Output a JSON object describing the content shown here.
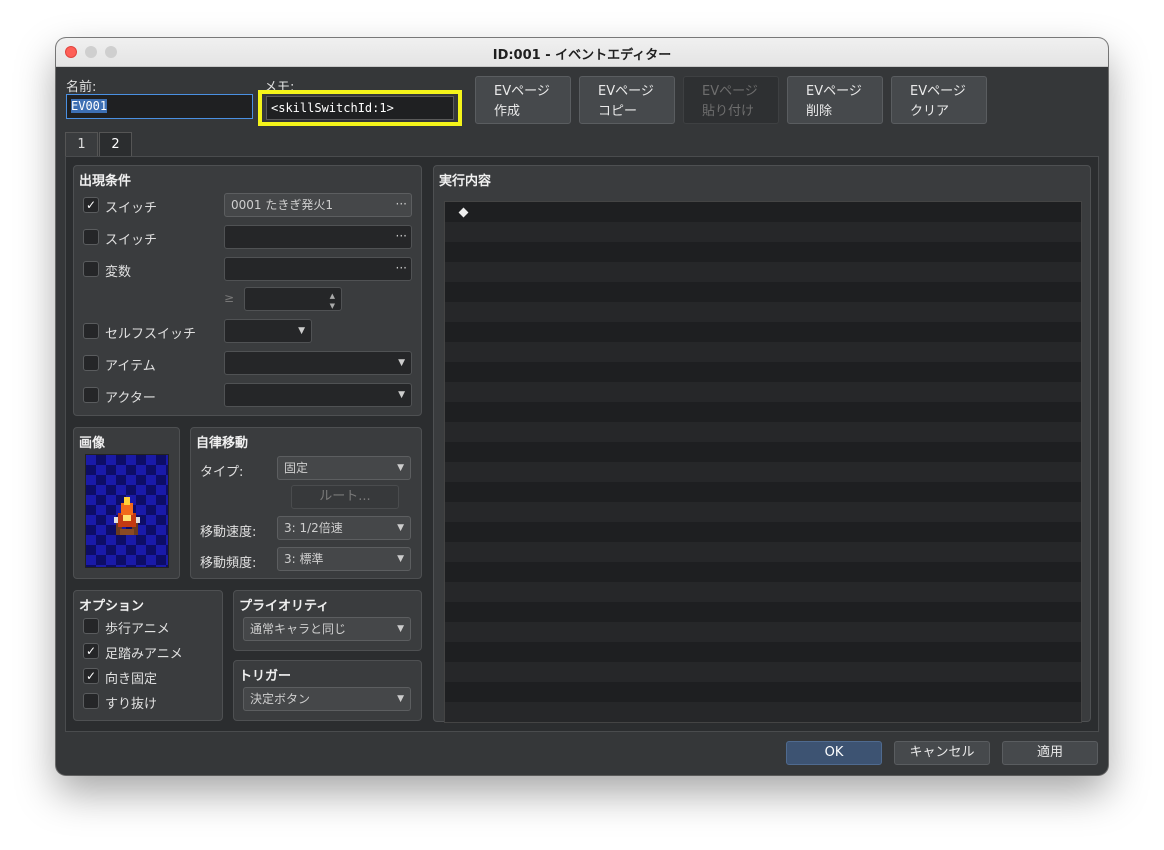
{
  "window": {
    "title": "ID:001 - イベントエディター"
  },
  "header": {
    "name_label": "名前:",
    "name_value": "EV001",
    "memo_label": "メモ:",
    "memo_value": "<skillSwitchId:1>",
    "buttons": [
      {
        "line1": "EVページ",
        "line2": "作成",
        "enabled": true
      },
      {
        "line1": "EVページ",
        "line2": "コピー",
        "enabled": true
      },
      {
        "line1": "EVページ",
        "line2": "貼り付け",
        "enabled": false
      },
      {
        "line1": "EVページ",
        "line2": "削除",
        "enabled": true
      },
      {
        "line1": "EVページ",
        "line2": "クリア",
        "enabled": true
      }
    ]
  },
  "tabs": [
    "1",
    "2"
  ],
  "active_tab": "2",
  "conditions": {
    "title": "出現条件",
    "switch1": {
      "label": "スイッチ",
      "checked": true,
      "value": "0001 たきぎ発火1"
    },
    "switch2": {
      "label": "スイッチ",
      "checked": false,
      "value": ""
    },
    "variable": {
      "label": "変数",
      "checked": false,
      "value": "",
      "operator": "≥",
      "number": ""
    },
    "self_switch": {
      "label": "セルフスイッチ",
      "checked": false,
      "value": ""
    },
    "item": {
      "label": "アイテム",
      "checked": false,
      "value": ""
    },
    "actor": {
      "label": "アクター",
      "checked": false,
      "value": ""
    }
  },
  "image": {
    "title": "画像"
  },
  "autonomous": {
    "title": "自律移動",
    "type_label": "タイプ:",
    "type_value": "固定",
    "route_button": "ルート...",
    "speed_label": "移動速度:",
    "speed_value": "3: 1/2倍速",
    "freq_label": "移動頻度:",
    "freq_value": "3: 標準"
  },
  "options": {
    "title": "オプション",
    "items": [
      {
        "label": "歩行アニメ",
        "checked": false
      },
      {
        "label": "足踏みアニメ",
        "checked": true
      },
      {
        "label": "向き固定",
        "checked": true
      },
      {
        "label": "すり抜け",
        "checked": false
      }
    ]
  },
  "priority": {
    "title": "プライオリティ",
    "value": "通常キャラと同じ"
  },
  "trigger": {
    "title": "トリガー",
    "value": "決定ボタン"
  },
  "contents": {
    "title": "実行内容"
  },
  "footer": {
    "ok": "OK",
    "cancel": "キャンセル",
    "apply": "適用"
  },
  "icons": {
    "check": "✓",
    "dots": "···",
    "dropdown": "▼",
    "spin_up": "▲",
    "spin_down": "▼"
  }
}
